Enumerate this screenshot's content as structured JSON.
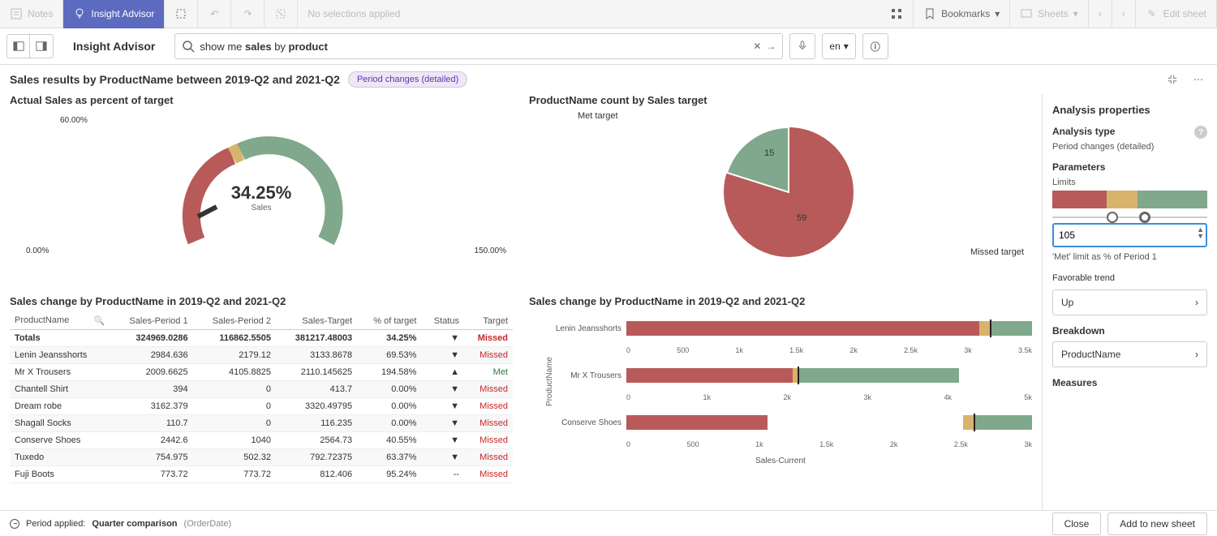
{
  "topbar": {
    "notes": "Notes",
    "insightAdvisor": "Insight Advisor",
    "noSelections": "No selections applied",
    "bookmarks": "Bookmarks",
    "sheets": "Sheets",
    "editSheet": "Edit sheet"
  },
  "search": {
    "iaTitle": "Insight Advisor",
    "value": "show me sales by product",
    "lang": "en"
  },
  "header": {
    "title": "Sales results by ProductName between 2019-Q2 and 2021-Q2",
    "chip": "Period changes (detailed)"
  },
  "gauge": {
    "title": "Actual Sales as percent of target",
    "leftLabel": "0.00%",
    "topLabel": "60.00%",
    "rightLabel": "150.00%",
    "centerValue": "34.25%",
    "centerLabel": "Sales"
  },
  "pie": {
    "title": "ProductName count by Sales target",
    "metLabel": "Met target",
    "metValue": "15",
    "missedLabel": "Missed target",
    "missedValue": "59"
  },
  "table": {
    "title": "Sales change by ProductName in 2019-Q2 and 2021-Q2",
    "cols": [
      "ProductName",
      "Sales-Period 1",
      "Sales-Period 2",
      "Sales-Target",
      "% of target",
      "Status",
      "Target"
    ],
    "totals": {
      "name": "Totals",
      "p1": "324969.0286",
      "p2": "116862.5505",
      "target": "381217.48003",
      "pct": "34.25%",
      "status": "▼",
      "result": "Missed"
    },
    "rows": [
      {
        "name": "Lenin Jeansshorts",
        "p1": "2984.636",
        "p2": "2179.12",
        "target": "3133.8678",
        "pct": "69.53%",
        "status": "▼",
        "result": "Missed"
      },
      {
        "name": "Mr X Trousers",
        "p1": "2009.6625",
        "p2": "4105.8825",
        "target": "2110.145625",
        "pct": "194.58%",
        "status": "▲",
        "result": "Met"
      },
      {
        "name": "Chantell Shirt",
        "p1": "394",
        "p2": "0",
        "target": "413.7",
        "pct": "0.00%",
        "status": "▼",
        "result": "Missed"
      },
      {
        "name": "Dream robe",
        "p1": "3162.379",
        "p2": "0",
        "target": "3320.49795",
        "pct": "0.00%",
        "status": "▼",
        "result": "Missed"
      },
      {
        "name": "Shagall Socks",
        "p1": "110.7",
        "p2": "0",
        "target": "116.235",
        "pct": "0.00%",
        "status": "▼",
        "result": "Missed"
      },
      {
        "name": "Conserve Shoes",
        "p1": "2442.6",
        "p2": "1040",
        "target": "2564.73",
        "pct": "40.55%",
        "status": "▼",
        "result": "Missed"
      },
      {
        "name": "Tuxedo",
        "p1": "754.975",
        "p2": "502.32",
        "target": "792.72375",
        "pct": "63.37%",
        "status": "▼",
        "result": "Missed"
      },
      {
        "name": "Fuji Boots",
        "p1": "773.72",
        "p2": "773.72",
        "target": "812.406",
        "pct": "95.24%",
        "status": "--",
        "result": "Missed"
      }
    ]
  },
  "bars": {
    "title": "Sales change by ProductName in 2019-Q2 and 2021-Q2",
    "ylabel": "ProductName",
    "xlabel": "Sales-Current",
    "groups": [
      {
        "name": "Lenin Jeansshorts",
        "ticks": [
          "0",
          "500",
          "1k",
          "1.5k",
          "2k",
          "2.5k",
          "3k",
          "3.5k"
        ]
      },
      {
        "name": "Mr X Trousers",
        "ticks": [
          "0",
          "1k",
          "2k",
          "3k",
          "4k",
          "5k"
        ]
      },
      {
        "name": "Conserve Shoes",
        "ticks": [
          "0",
          "500",
          "1k",
          "1.5k",
          "2k",
          "2.5k",
          "3k"
        ]
      }
    ]
  },
  "side": {
    "title": "Analysis properties",
    "analysisType": "Analysis type",
    "analysisTypeValue": "Period changes (detailed)",
    "parameters": "Parameters",
    "limits": "Limits",
    "limitValue": "105",
    "limitCaption": "'Met' limit as % of Period 1",
    "favTrend": "Favorable trend",
    "favTrendValue": "Up",
    "breakdown": "Breakdown",
    "breakdownValue": "ProductName",
    "measures": "Measures"
  },
  "footer": {
    "periodApplied": "Period applied:",
    "periodValue": "Quarter comparison",
    "periodField": "(OrderDate)",
    "close": "Close",
    "addToSheet": "Add to new sheet"
  },
  "chart_data": [
    {
      "type": "gauge",
      "title": "Actual Sales as percent of target",
      "value": 34.25,
      "min": 0,
      "max": 150,
      "bands": [
        {
          "from": 0,
          "to": 60,
          "color": "#b85a5a"
        },
        {
          "from": 60,
          "to": 65,
          "color": "#d8b36c"
        },
        {
          "from": 65,
          "to": 150,
          "color": "#7fa88c"
        }
      ],
      "unit": "%",
      "label": "Sales"
    },
    {
      "type": "pie",
      "title": "ProductName count by Sales target",
      "series": [
        {
          "name": "Met target",
          "value": 15,
          "color": "#7fa88c"
        },
        {
          "name": "Missed target",
          "value": 59,
          "color": "#b85a5a"
        }
      ]
    },
    {
      "type": "table",
      "title": "Sales change by ProductName in 2019-Q2 and 2021-Q2",
      "columns": [
        "ProductName",
        "Sales-Period 1",
        "Sales-Period 2",
        "Sales-Target",
        "% of target",
        "Status",
        "Target"
      ],
      "rows": [
        [
          "Totals",
          324969.0286,
          116862.5505,
          381217.48003,
          34.25,
          "down",
          "Missed"
        ],
        [
          "Lenin Jeansshorts",
          2984.636,
          2179.12,
          3133.8678,
          69.53,
          "down",
          "Missed"
        ],
        [
          "Mr X Trousers",
          2009.6625,
          4105.8825,
          2110.145625,
          194.58,
          "up",
          "Met"
        ],
        [
          "Chantell Shirt",
          394,
          0,
          413.7,
          0.0,
          "down",
          "Missed"
        ],
        [
          "Dream robe",
          3162.379,
          0,
          3320.49795,
          0.0,
          "down",
          "Missed"
        ],
        [
          "Shagall Socks",
          110.7,
          0,
          116.235,
          0.0,
          "down",
          "Missed"
        ],
        [
          "Conserve Shoes",
          2442.6,
          1040,
          2564.73,
          40.55,
          "down",
          "Missed"
        ],
        [
          "Tuxedo",
          754.975,
          502.32,
          792.72375,
          63.37,
          "down",
          "Missed"
        ],
        [
          "Fuji Boots",
          773.72,
          773.72,
          812.406,
          95.24,
          "flat",
          "Missed"
        ]
      ]
    },
    {
      "type": "bar",
      "title": "Sales change by ProductName in 2019-Q2 and 2021-Q2",
      "orientation": "horizontal",
      "xlabel": "Sales-Current",
      "ylabel": "ProductName",
      "note": "Each product has its own x-axis scale; bars show three segments (red/tan/green) with black target marker",
      "products": [
        {
          "name": "Lenin Jeansshorts",
          "xmax": 3500,
          "target": 3134,
          "segments": {
            "red": [
              0,
              3050
            ],
            "tan": [
              3050,
              3134
            ],
            "green": [
              3134,
              3500
            ]
          }
        },
        {
          "name": "Mr X Trousers",
          "xmax": 5000,
          "target": 2110,
          "segments": {
            "red": [
              0,
              2050
            ],
            "tan": [
              2050,
              2110
            ],
            "green": [
              2110,
              4106
            ]
          }
        },
        {
          "name": "Conserve Shoes",
          "xmax": 3000,
          "target": 2565,
          "segments": {
            "red": [
              0,
              1040
            ],
            "tan": [
              2490,
              2565
            ],
            "green": [
              2565,
              3000
            ]
          }
        }
      ]
    }
  ]
}
